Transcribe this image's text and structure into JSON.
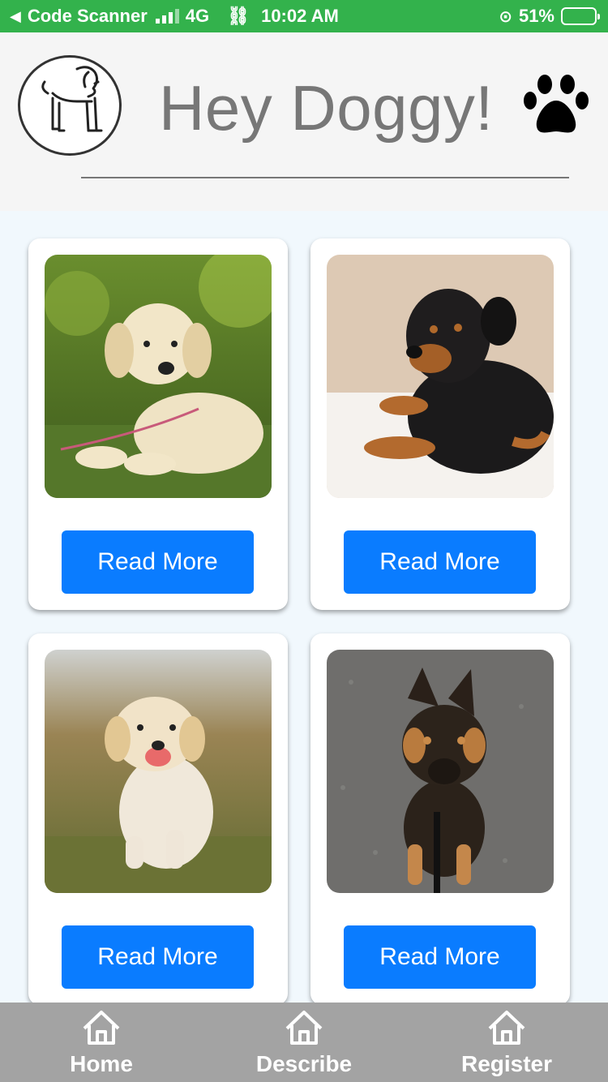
{
  "status_bar": {
    "back_app": "Code Scanner",
    "network": "4G",
    "time": "10:02 AM",
    "battery": "51%",
    "battery_level": 0.51
  },
  "header": {
    "title": "Hey Doggy!",
    "logo_icon": "dog-logo-icon",
    "paw_icon": "paw-icon"
  },
  "cards": [
    {
      "button_label": "Read More",
      "photo": "yellow-lab-puppy"
    },
    {
      "button_label": "Read More",
      "photo": "rottweiler-puppy"
    },
    {
      "button_label": "Read More",
      "photo": "golden-retriever-puppy"
    },
    {
      "button_label": "Read More",
      "photo": "german-shepherd-puppy"
    }
  ],
  "bottom_nav": [
    {
      "label": "Home",
      "icon": "home-icon"
    },
    {
      "label": "Describe",
      "icon": "home-icon"
    },
    {
      "label": "Register",
      "icon": "home-icon"
    }
  ],
  "colors": {
    "status_bar": "#33b24c",
    "button": "#0a7cff",
    "bottom_nav": "#a3a3a3",
    "title": "#777777"
  }
}
